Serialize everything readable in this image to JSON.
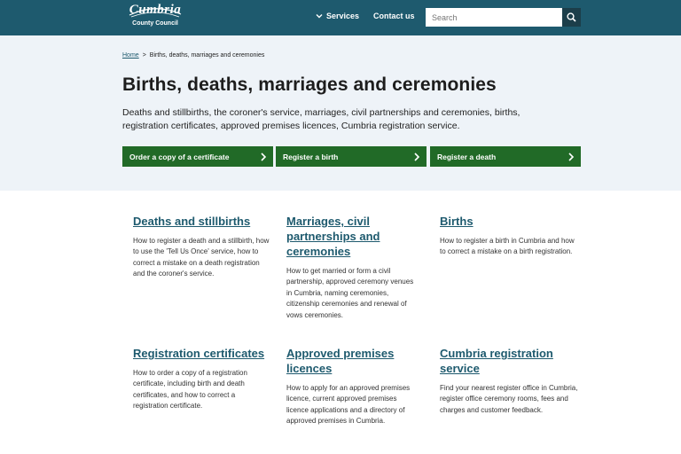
{
  "header": {
    "logo_top": "Cumbria",
    "logo_bottom": "County Council",
    "nav_services": "Services",
    "nav_contact": "Contact us",
    "search_placeholder": "Search",
    "colors": {
      "header_bg": "#1e5a6e",
      "search_button": "#1c3e4a"
    }
  },
  "breadcrumb": {
    "home": "Home",
    "separator": ">",
    "current": "Births, deaths, marriages and ceremonies"
  },
  "page": {
    "title": "Births, deaths, marriages and ceremonies",
    "intro": "Deaths and stillbirths, the coroner's service, marriages, civil partnerships and ceremonies, births, registration certificates, approved premises licences, Cumbria registration service."
  },
  "actions": [
    {
      "label": "Order a copy of a certificate",
      "icon": "chevron-right-icon"
    },
    {
      "label": "Register a birth",
      "icon": "chevron-right-icon"
    },
    {
      "label": "Register a death",
      "icon": "chevron-right-icon"
    }
  ],
  "action_color": "#216a27",
  "cards": [
    {
      "title": "Deaths and stillbirths",
      "description": "How to register a death and a stillbirth, how to use the 'Tell Us Once' service, how to correct a mistake on a death registration and the coroner's service."
    },
    {
      "title": "Marriages, civil partnerships and ceremonies",
      "description": "How to get married or form a civil partnership, approved ceremony venues in Cumbria, naming ceremonies, citizenship ceremonies and renewal of vows ceremonies."
    },
    {
      "title": "Births",
      "description": "How to register a birth in Cumbria and how to correct a mistake on a birth registration."
    },
    {
      "title": "Registration certificates",
      "description": "How to order a copy of a registration certificate, including birth and death certificates, and how to correct a registration certificate."
    },
    {
      "title": "Approved premises licences",
      "description": "How to apply for an approved premises licence, current approved premises licence applications and a directory of approved premises in Cumbria."
    },
    {
      "title": "Cumbria registration service",
      "description": "Find your nearest register office in Cumbria, register office ceremony rooms, fees and charges and customer feedback."
    }
  ]
}
